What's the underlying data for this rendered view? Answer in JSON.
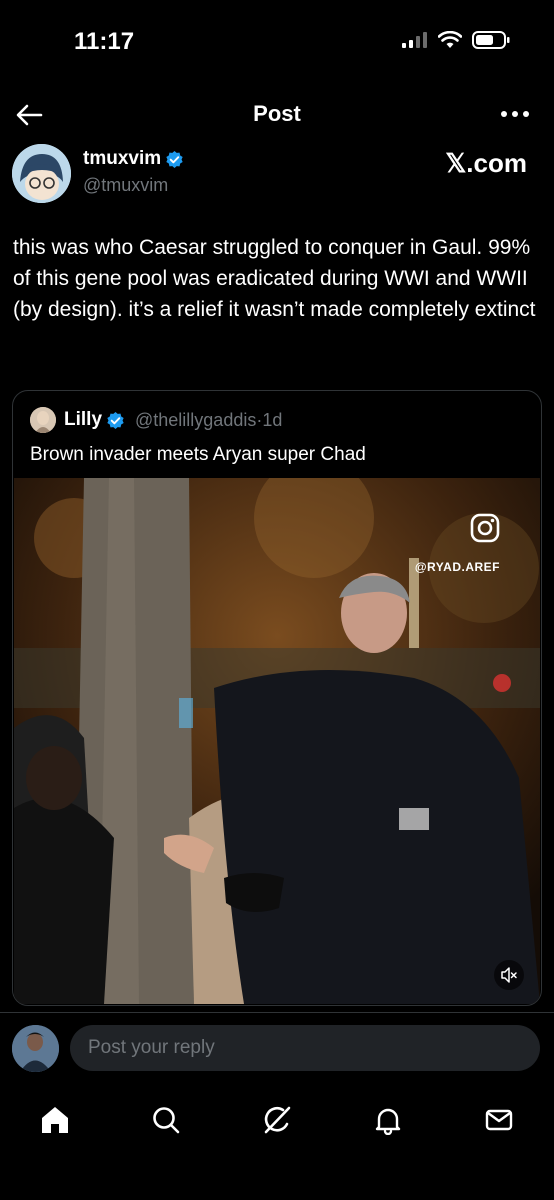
{
  "status_bar": {
    "time": "11:17"
  },
  "header": {
    "title": "Post"
  },
  "post": {
    "author": {
      "name": "tmuxvim",
      "handle": "@tmuxvim"
    },
    "watermark": "𝕏.com",
    "text": "this was who Caesar struggled to conquer in Gaul. 99% of this gene pool was eradicated during WWI and WWII (by design). it’s a relief it wasn’t made completely extinct",
    "quote": {
      "author": {
        "name": "Lilly",
        "handle": "@thelillygaddis",
        "separator": "·",
        "age": "1d"
      },
      "text": "Brown invader meets Aryan super Chad",
      "video": {
        "credit": "@RYAD.AREF"
      }
    }
  },
  "reply": {
    "placeholder": "Post your reply"
  },
  "colors": {
    "background": "#000000",
    "accent": "#1d9bf0",
    "muted": "#71767b",
    "border": "#2f3336"
  }
}
